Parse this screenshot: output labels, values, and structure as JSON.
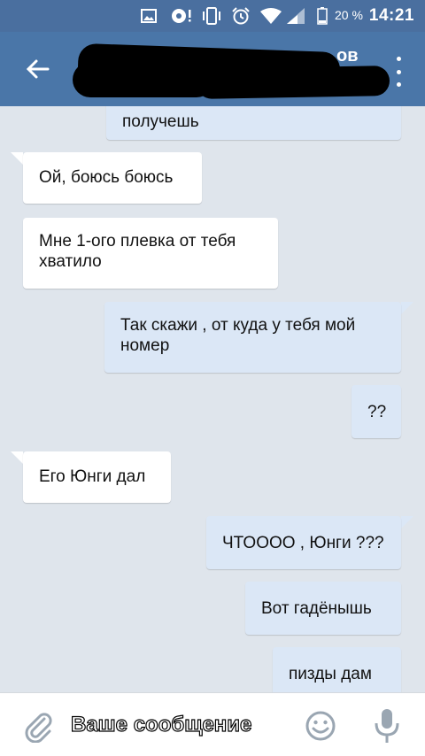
{
  "status_bar": {
    "battery_percent": "20 %",
    "time": "14:21",
    "icons": [
      "image-icon",
      "sync-alert-icon",
      "vibrate-icon",
      "alarm-icon",
      "wifi-icon",
      "signal-icon",
      "battery-icon"
    ]
  },
  "header": {
    "title_visible_fragment": "ов",
    "back_icon": "arrow-left-icon",
    "menu_icon": "more-vert-icon"
  },
  "messages": [
    {
      "direction": "out",
      "text": "получешь"
    },
    {
      "direction": "in",
      "text": "Ой, боюсь боюсь"
    },
    {
      "direction": "in",
      "text": "Мне 1-ого плевка от тебя хватило"
    },
    {
      "direction": "out",
      "text": "Так скажи , от куда у тебя мой номер"
    },
    {
      "direction": "out",
      "text": "??"
    },
    {
      "direction": "in",
      "text": "Его Юнги дал"
    },
    {
      "direction": "out",
      "text": "ЧТОООО , Юнги ???"
    },
    {
      "direction": "out",
      "text": "Вот гадёнышь"
    },
    {
      "direction": "out",
      "text": "пизды дам"
    }
  ],
  "composer": {
    "placeholder": "Ваше сообщение",
    "value": "",
    "attach_icon": "paperclip-icon",
    "emoji_icon": "smiley-icon",
    "mic_icon": "microphone-icon"
  },
  "colors": {
    "header": "#4a76a8",
    "status_bar": "#4a6f9f",
    "chat_bg": "#dfe5ec",
    "bubble_in": "#ffffff",
    "bubble_out": "#dbe7f6",
    "icon_gray": "#9aa6b2"
  }
}
